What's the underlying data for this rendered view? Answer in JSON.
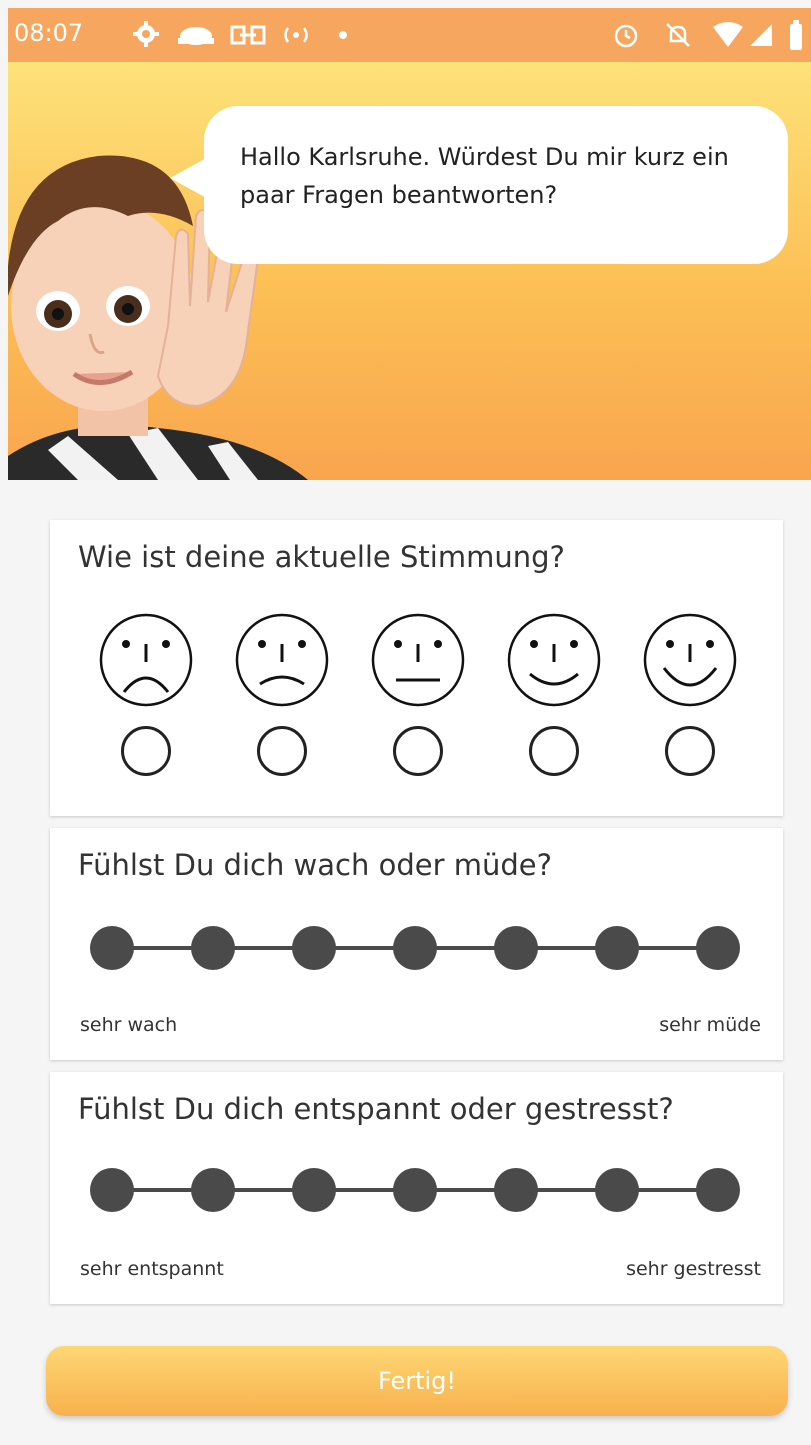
{
  "status_bar": {
    "time": "08:07",
    "left_icons": [
      "gear-icon",
      "cloud-icon",
      "link-icon",
      "radio-waves-icon",
      "dot-icon"
    ],
    "right_icons": [
      "alarm-icon",
      "bell-off-icon",
      "wifi-icon",
      "signal-icon",
      "battery-icon"
    ]
  },
  "header": {
    "greeting": "Hallo Karlsruhe. Würdest Du mir kurz ein paar Fragen beantworten?"
  },
  "mood": {
    "question": "Wie ist deine aktuelle Stimmung?",
    "options": [
      "very-sad-face-icon",
      "sad-face-icon",
      "neutral-face-icon",
      "happy-face-icon",
      "very-happy-face-icon"
    ]
  },
  "alertness": {
    "question": "Fühlst Du dich wach oder müde?",
    "steps": 7,
    "min_label": "sehr wach",
    "max_label": "sehr müde"
  },
  "stress": {
    "question": "Fühlst Du dich entspannt oder gestresst?",
    "steps": 7,
    "min_label": "sehr entspannt",
    "max_label": "sehr gestresst"
  },
  "finish_button": {
    "label": "Fertig!"
  },
  "colors": {
    "status_bar": "#f7a65f",
    "header_top": "#fde27a",
    "header_bottom": "#f9a54e",
    "scale": "#4a4a4a",
    "button_top": "#fdd774",
    "button_bottom": "#f8b14e"
  }
}
